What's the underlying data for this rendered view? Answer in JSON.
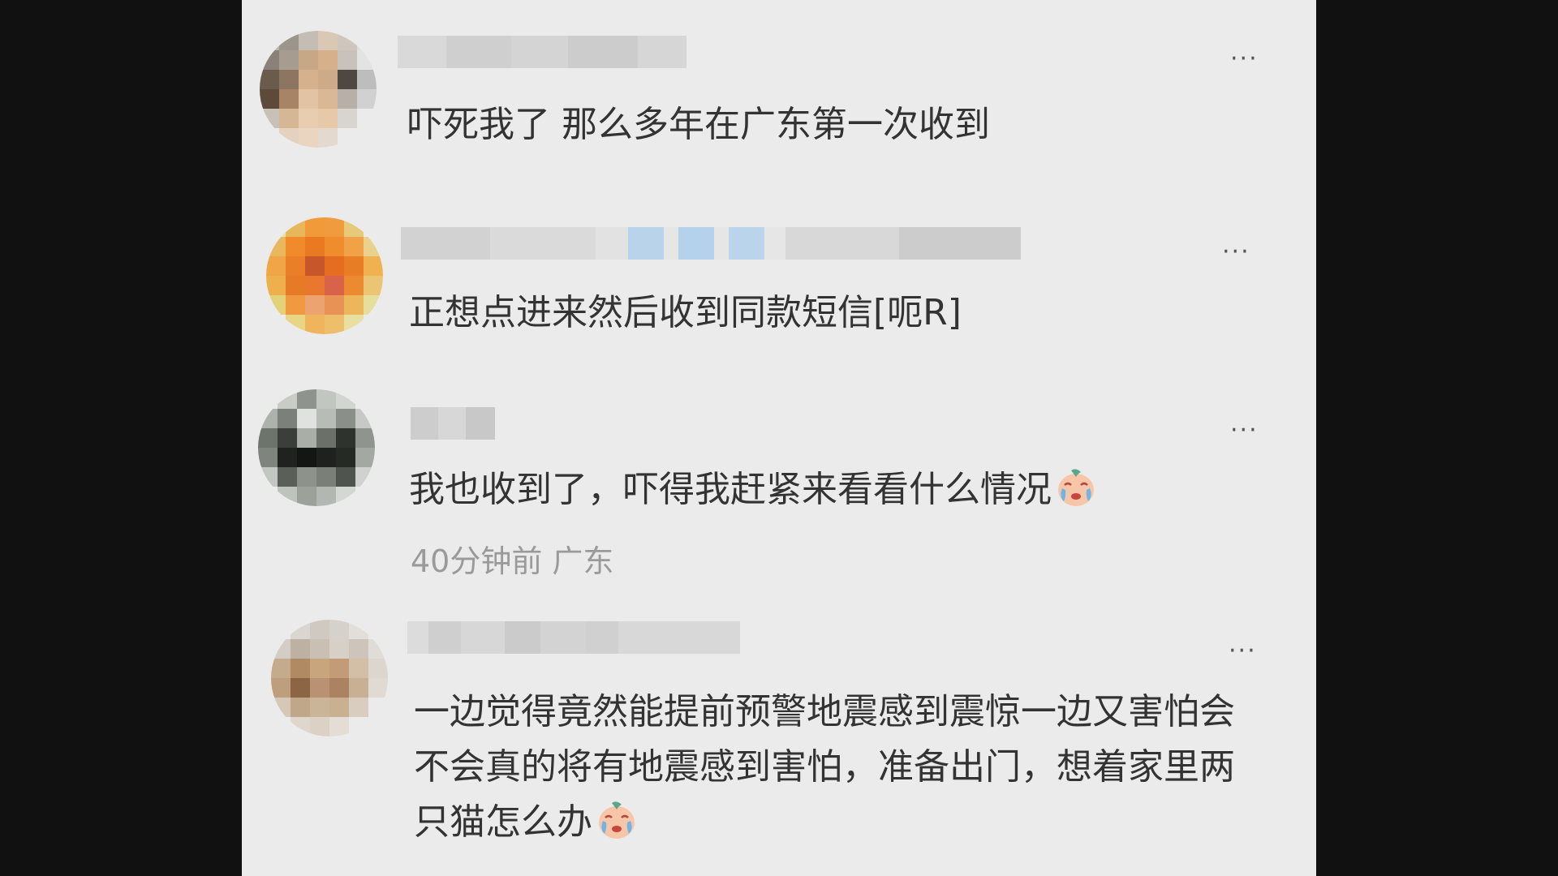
{
  "comments": [
    {
      "text": "吓死我了 那么多年在广东第一次收到",
      "more_label": "···"
    },
    {
      "text": "正想点进来然后收到同款短信[呃R]",
      "more_label": "···"
    },
    {
      "text": "我也收到了，吓得我赶紧来看看什么情况",
      "emoji": "crying-face-icon",
      "meta": "40分钟前  广东",
      "more_label": "···"
    },
    {
      "text": "一边觉得竟然能提前预警地震感到震惊一边又害怕会不会真的将有地震感到害怕，准备出门，想着家里两只猫怎么办",
      "emoji": "crying-face-icon",
      "more_label": "···"
    }
  ],
  "colors": {
    "background": "#ebebeb",
    "letterbox": "#111111",
    "comment_text": "#333333",
    "meta_text": "#9a9a9a"
  }
}
